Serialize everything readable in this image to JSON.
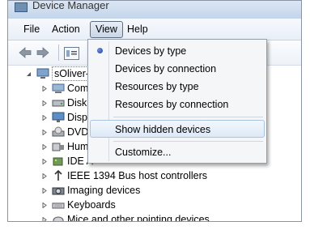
{
  "window": {
    "title": "Device Manager"
  },
  "menubar": {
    "file": "File",
    "action": "Action",
    "view": "View",
    "help": "Help"
  },
  "toolbar": {
    "back_icon": "back-arrow-icon",
    "forward_icon": "forward-arrow-icon",
    "view_icon": "properties-icon"
  },
  "tree": {
    "root": "sOliver-",
    "items": [
      {
        "label": "Com",
        "icon": "computer-icon"
      },
      {
        "label": "Disk",
        "icon": "disk-drive-icon"
      },
      {
        "label": "Disp",
        "icon": "display-adapter-icon"
      },
      {
        "label": "DVD",
        "icon": "dvd-drive-icon"
      },
      {
        "label": "Hum",
        "icon": "hid-icon"
      },
      {
        "label": "IDE A",
        "icon": "ide-controller-icon"
      },
      {
        "label": "IEEE 1394 Bus host controllers",
        "icon": "ieee1394-icon"
      },
      {
        "label": "Imaging devices",
        "icon": "camera-icon"
      },
      {
        "label": "Keyboards",
        "icon": "keyboard-icon"
      },
      {
        "label": "Mice and other pointing devices",
        "icon": "mouse-icon"
      }
    ]
  },
  "view_menu": {
    "items": [
      {
        "label": "Devices by type",
        "selected": true
      },
      {
        "label": "Devices by connection"
      },
      {
        "label": "Resources by type"
      },
      {
        "label": "Resources by connection"
      },
      {
        "label": "Show hidden devices"
      },
      {
        "label": "Customize..."
      }
    ],
    "radio_color": "#1a3fa7",
    "highlight_color": "#dde9f7"
  }
}
